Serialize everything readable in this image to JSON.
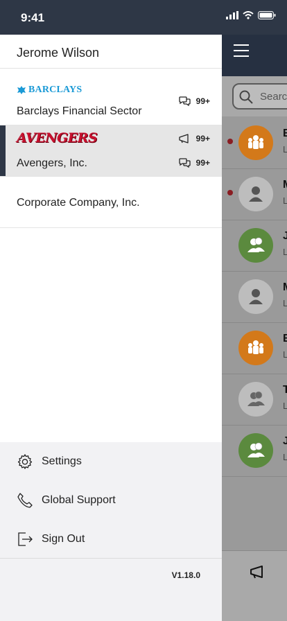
{
  "status_bar": {
    "time": "9:41",
    "icons": [
      "signal-icon",
      "wifi-icon",
      "battery-icon"
    ]
  },
  "drawer": {
    "user_name": "Jerome Wilson",
    "companies": [
      {
        "name": "Barclays Financial Sector",
        "logo_text": "BARCLAYS",
        "chat_count": "99+",
        "active": false
      },
      {
        "name": "Avengers, Inc.",
        "logo_text": "AVENGERS",
        "announcement_count": "99+",
        "chat_count": "99+",
        "active": true
      },
      {
        "name": "Corporate Company, Inc.",
        "active": false
      }
    ],
    "menu": [
      {
        "label": "Settings",
        "icon": "gear-icon"
      },
      {
        "label": "Global Support",
        "icon": "phone-icon"
      },
      {
        "label": "Sign Out",
        "icon": "sign-out-icon"
      }
    ],
    "version": "V1.18.0"
  },
  "app": {
    "search_placeholder": "Search",
    "conversations": [
      {
        "title": "E",
        "sub": "L",
        "unread": true,
        "avatar": "group-icon",
        "color": "#d3791a"
      },
      {
        "title": "M",
        "sub": "L",
        "unread": true,
        "avatar": "person-icon",
        "color": "#bdbdbd"
      },
      {
        "title": "J",
        "sub": "L",
        "unread": false,
        "avatar": "pair-icon",
        "color": "#5b8a3e"
      },
      {
        "title": "M",
        "sub": "L",
        "unread": false,
        "avatar": "person-icon",
        "color": "#bdbdbd"
      },
      {
        "title": "E",
        "sub": "L",
        "unread": false,
        "avatar": "group-icon",
        "color": "#d3791a"
      },
      {
        "title": "T",
        "sub": "L",
        "unread": false,
        "avatar": "pair-icon",
        "color": "#bdbdbd"
      },
      {
        "title": "J",
        "sub": "L",
        "unread": false,
        "avatar": "pair-icon",
        "color": "#5b8a3e"
      }
    ],
    "footer_icon": "megaphone-icon"
  },
  "colors": {
    "header_dark": "#2e3746",
    "unread": "#8a1d22",
    "barclays_blue": "#1b9ad6",
    "avengers_red": "#c8102e"
  }
}
